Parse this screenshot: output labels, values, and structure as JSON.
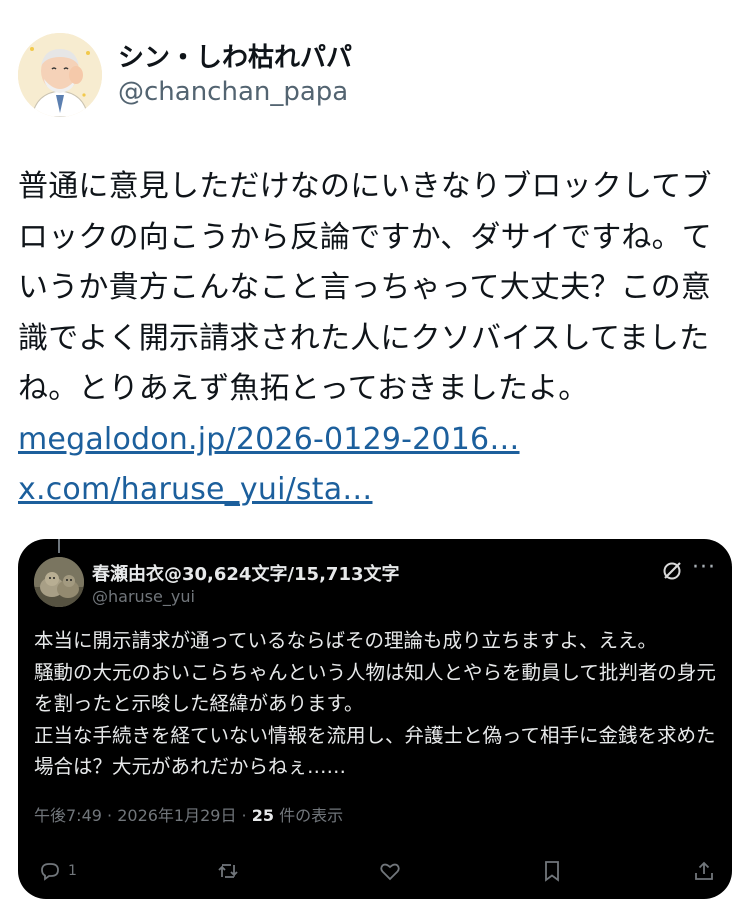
{
  "author": {
    "display_name": "シン・しわ枯れパパ",
    "handle": "@chanchan_papa"
  },
  "post": {
    "text": "普通に意見しただけなのにいきなりブロックしてブロックの向こうから反論ですか、ダサイですね。ていうか貴方こんなこと言っちゃって大丈夫？この意識でよく開示請求された人にクソバイスしてましたね。とりあえず魚拓とっておきましたよ。",
    "links": [
      "megalodon.jp/2026-0129-2016…",
      "x.com/haruse_yui/sta…"
    ]
  },
  "quoted": {
    "display_name": "春瀬由衣@30,624文字/15,713文字",
    "handle": "@haruse_yui",
    "text": "本当に開示請求が通っているならばその理論も成り立ちますよ、ええ。\n騒動の大元のおいこらちゃんという人物は知人とやらを動員して批判者の身元を割ったと示唆した経緯があります。\n正当な手続きを経ていない情報を流用し、弁護士と偽って相手に金銭を求めた場合は？大元があれだからねぇ……",
    "meta": {
      "time": "午後7:49",
      "sep1": " · ",
      "date": "2026年1月29日",
      "sep2": " · ",
      "views": "25",
      "views_label": " 件の表示"
    },
    "reply_count": "1",
    "icons": [
      "reply-icon",
      "retweet-icon",
      "like-icon",
      "bookmark-icon",
      "share-icon"
    ]
  },
  "colors": {
    "link": "#1c5f9c",
    "quote_background": "#000000",
    "muted": "#71767b"
  }
}
